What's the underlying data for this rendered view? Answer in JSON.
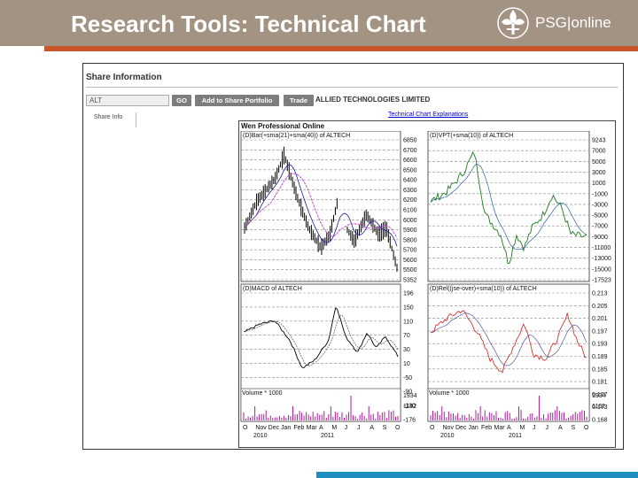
{
  "header": {
    "title": "Research Tools: Technical Chart",
    "logo_text": "PSG|online",
    "bar_color": "#a39382",
    "accent_color": "#c9562a"
  },
  "share_info": {
    "heading": "Share Information",
    "ticker_value": "ALT",
    "go_label": "GO",
    "add_label": "Add to Share Portfolio",
    "trade_label": "Trade",
    "company": "ALLIED TECHNOLOGIES LIMITED",
    "tab_label": "Share Info",
    "link_label": "Technical Chart Explanations"
  },
  "chart_header": "Wen Professional Online",
  "panels": {
    "bar": {
      "title": "(D)Bar(+sma(21)+sma(40)) of ALTECH",
      "ticks": [
        "6850",
        "6700",
        "6600",
        "6500",
        "6400",
        "6300",
        "6200",
        "6100",
        "6000",
        "5900",
        "5800",
        "5700",
        "5600",
        "5500",
        "5352"
      ]
    },
    "vpt": {
      "title": "(D)VPT(+sma(10)) of ALTECH",
      "ticks": [
        "9243",
        "7000",
        "5000",
        "3000",
        "1000",
        "-1000",
        "-3000",
        "-5000",
        "-7000",
        "-9000",
        "-11000",
        "-13000",
        "-15000",
        "-17523"
      ]
    },
    "macd": {
      "title": "(D)MACD of ALTECH",
      "ticks": [
        "196",
        "150",
        "110",
        "70",
        "30",
        "10",
        "-50",
        "-90",
        "-130",
        "-176"
      ],
      "volume_label": "Volume * 1000",
      "volume_ticks": [
        "1934",
        "1162"
      ]
    },
    "rel": {
      "title": "(D)Rel((jse-over)+sma(10)) of ALTECH",
      "ticks": [
        "0.213",
        "0.205",
        "0.201",
        "0.197",
        "0.193",
        "0.189",
        "0.185",
        "0.181",
        "0.177",
        "0.173",
        "0.168"
      ],
      "volume_label": "Volume * 1000",
      "volume_ticks": [
        "1934",
        "1162"
      ]
    },
    "months": [
      "O",
      "Nov",
      "Dec",
      "Jan",
      "Feb",
      "Mar",
      "A",
      "M",
      "J",
      "J",
      "A",
      "S",
      "O"
    ],
    "years": [
      "2010",
      "2011"
    ]
  }
}
